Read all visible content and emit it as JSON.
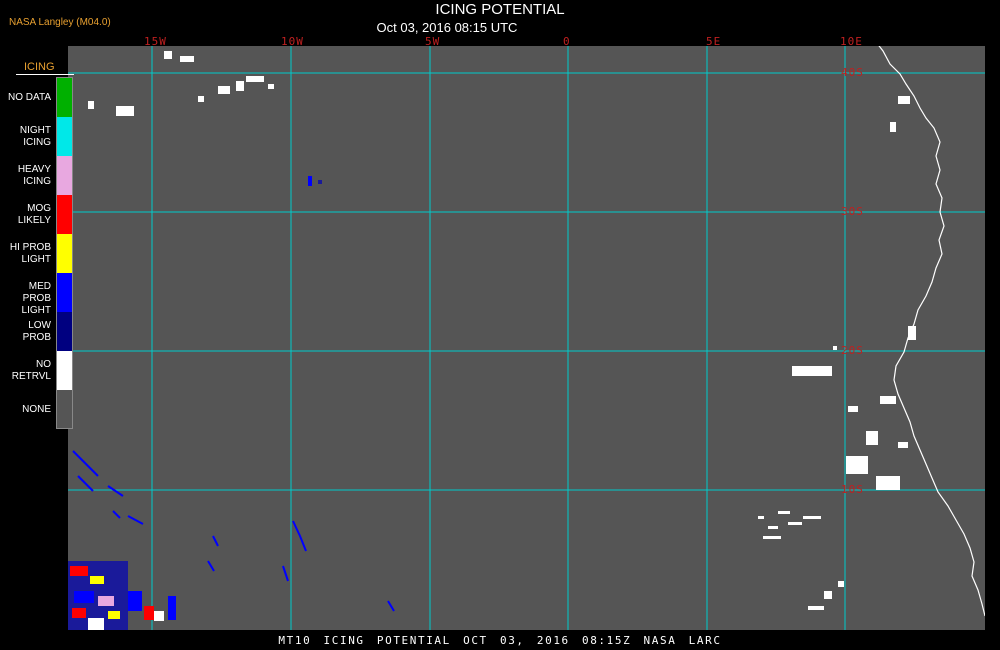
{
  "header": {
    "credit": "NASA Langley (M04.0)",
    "title": "ICING POTENTIAL",
    "subtitle": "Oct 03, 2016 08:15 UTC"
  },
  "legend": {
    "title": "ICING",
    "items": [
      {
        "label": "NO DATA",
        "color": "#00b000"
      },
      {
        "label": "NIGHT ICING",
        "color": "#00e8e8"
      },
      {
        "label": "HEAVY ICING",
        "color": "#e8a8e0"
      },
      {
        "label": "MOG LIKELY",
        "color": "#ff0000"
      },
      {
        "label": "HI PROB LIGHT",
        "color": "#ffff00"
      },
      {
        "label": "MED PROB LIGHT",
        "color": "#0000ff"
      },
      {
        "label": "LOW PROB",
        "color": "#000080"
      },
      {
        "label": "NO RETRVL",
        "color": "#ffffff"
      },
      {
        "label": "NONE",
        "color": "#555555"
      }
    ]
  },
  "grid": {
    "longitudes": [
      "15W",
      "10W",
      "5W",
      "0",
      "5E",
      "10E"
    ],
    "latitudes": [
      "40S",
      "30S",
      "20S",
      "10S"
    ],
    "grid_color": "#00d0d0",
    "label_color": "#c02020"
  },
  "footer": {
    "text": "MT10 ICING POTENTIAL OCT 03, 2016 08:15Z NASA LARC"
  }
}
